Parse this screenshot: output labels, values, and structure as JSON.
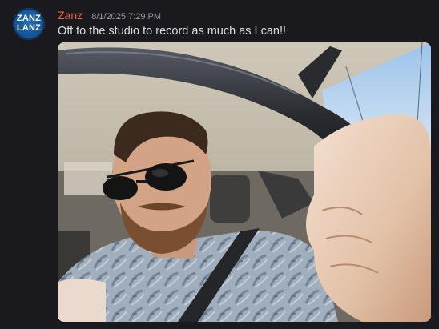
{
  "message": {
    "avatar": {
      "line1": "ZANZ",
      "line2": "LANZ"
    },
    "username": "Zanz",
    "timestamp": "8/1/2025 7:29 PM",
    "text": "Off to the studio to record as much as I can!!",
    "attachment": {
      "type": "photo",
      "icon": "car-selfie-image"
    }
  },
  "colors": {
    "background": "#1a1a1e",
    "username": "#e8613a",
    "timestamp": "#949ba4",
    "text": "#dbdee1"
  }
}
